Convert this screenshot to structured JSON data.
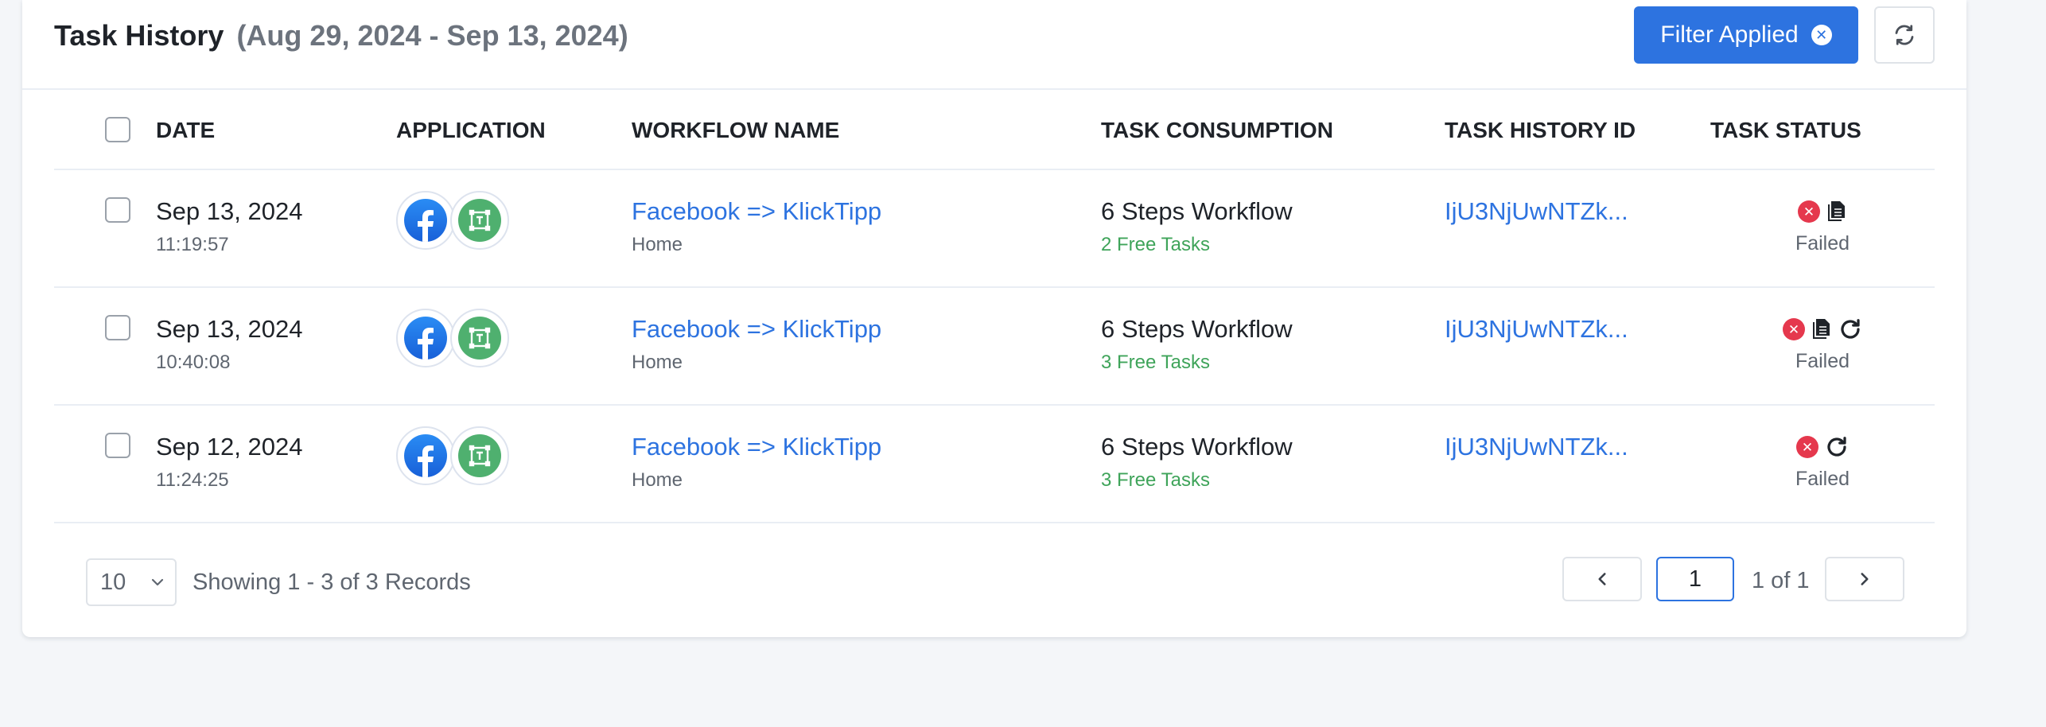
{
  "header": {
    "title": "Task History",
    "date_range": "(Aug 29, 2024 - Sep 13, 2024)",
    "filter_label": "Filter Applied"
  },
  "columns": {
    "date": "DATE",
    "application": "APPLICATION",
    "workflow_name": "WORKFLOW NAME",
    "task_consumption": "TASK CONSUMPTION",
    "task_history_id": "TASK HISTORY ID",
    "task_status": "TASK STATUS"
  },
  "rows": [
    {
      "date": "Sep 13, 2024",
      "time": "11:19:57",
      "apps": [
        "facebook-icon",
        "klicktipp-icon"
      ],
      "workflow": "Facebook => KlickTipp",
      "folder": "Home",
      "consumption": "6 Steps Workflow",
      "free_tasks": "2 Free Tasks",
      "history_id": "IjU3NjUwNTZk...",
      "status": "Failed",
      "actions": [
        "copy"
      ]
    },
    {
      "date": "Sep 13, 2024",
      "time": "10:40:08",
      "apps": [
        "facebook-icon",
        "klicktipp-icon"
      ],
      "workflow": "Facebook => KlickTipp",
      "folder": "Home",
      "consumption": "6 Steps Workflow",
      "free_tasks": "3 Free Tasks",
      "history_id": "IjU3NjUwNTZk...",
      "status": "Failed",
      "actions": [
        "copy",
        "retry"
      ]
    },
    {
      "date": "Sep 12, 2024",
      "time": "11:24:25",
      "apps": [
        "facebook-icon",
        "klicktipp-icon"
      ],
      "workflow": "Facebook => KlickTipp",
      "folder": "Home",
      "consumption": "6 Steps Workflow",
      "free_tasks": "3 Free Tasks",
      "history_id": "IjU3NjUwNTZk...",
      "status": "Failed",
      "actions": [
        "retry"
      ]
    }
  ],
  "footer": {
    "page_size": "10",
    "showing": "Showing 1 - 3 of 3 Records",
    "current_page": "1",
    "page_of": "1 of 1"
  },
  "colors": {
    "primary": "#2d73e0",
    "success_text": "#3fa45a",
    "failed": "#e5384d",
    "klicktipp": "#4fb06f"
  }
}
